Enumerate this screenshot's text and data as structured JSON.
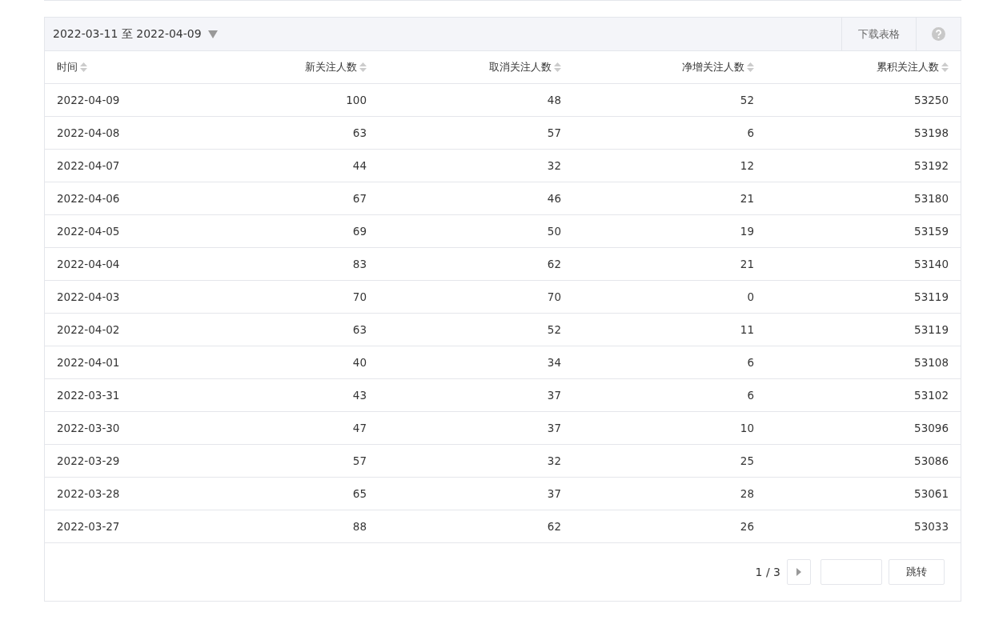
{
  "toolbar": {
    "date_range": "2022-03-11 至 2022-04-09",
    "download": "下载表格"
  },
  "table": {
    "columns": [
      "时间",
      "新关注人数",
      "取消关注人数",
      "净增关注人数",
      "累积关注人数"
    ],
    "rows": [
      [
        "2022-04-09",
        "100",
        "48",
        "52",
        "53250"
      ],
      [
        "2022-04-08",
        "63",
        "57",
        "6",
        "53198"
      ],
      [
        "2022-04-07",
        "44",
        "32",
        "12",
        "53192"
      ],
      [
        "2022-04-06",
        "67",
        "46",
        "21",
        "53180"
      ],
      [
        "2022-04-05",
        "69",
        "50",
        "19",
        "53159"
      ],
      [
        "2022-04-04",
        "83",
        "62",
        "21",
        "53140"
      ],
      [
        "2022-04-03",
        "70",
        "70",
        "0",
        "53119"
      ],
      [
        "2022-04-02",
        "63",
        "52",
        "11",
        "53119"
      ],
      [
        "2022-04-01",
        "40",
        "34",
        "6",
        "53108"
      ],
      [
        "2022-03-31",
        "43",
        "37",
        "6",
        "53102"
      ],
      [
        "2022-03-30",
        "47",
        "37",
        "10",
        "53096"
      ],
      [
        "2022-03-29",
        "57",
        "32",
        "25",
        "53086"
      ],
      [
        "2022-03-28",
        "65",
        "37",
        "28",
        "53061"
      ],
      [
        "2022-03-27",
        "88",
        "62",
        "26",
        "53033"
      ]
    ]
  },
  "pagination": {
    "page": "1 / 3",
    "jump": "跳转"
  }
}
